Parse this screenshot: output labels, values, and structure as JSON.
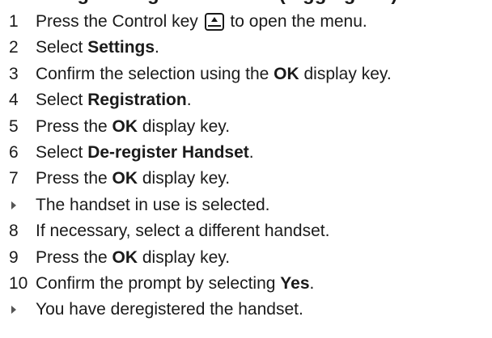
{
  "heading": "Deregistering the handset (logging out)",
  "steps": [
    {
      "num": "1",
      "parts": [
        {
          "t": "Press the Control key "
        },
        {
          "icon": "control-key-icon"
        },
        {
          "t": " to open the menu."
        }
      ]
    },
    {
      "num": "2",
      "parts": [
        {
          "t": "Select "
        },
        {
          "b": "Settings"
        },
        {
          "t": "."
        }
      ]
    },
    {
      "num": "3",
      "parts": [
        {
          "t": "Confirm the selection using the "
        },
        {
          "b": "OK"
        },
        {
          "t": " display key."
        }
      ]
    },
    {
      "num": "4",
      "parts": [
        {
          "t": "Select "
        },
        {
          "b": "Registration"
        },
        {
          "t": "."
        }
      ]
    },
    {
      "num": "5",
      "parts": [
        {
          "t": "Press the "
        },
        {
          "b": "OK"
        },
        {
          "t": " display key."
        }
      ]
    },
    {
      "num": "6",
      "parts": [
        {
          "t": "Select "
        },
        {
          "b": "De-register Handset"
        },
        {
          "t": "."
        }
      ]
    },
    {
      "num": "7",
      "parts": [
        {
          "t": "Press the "
        },
        {
          "b": "OK"
        },
        {
          "t": " display key."
        }
      ]
    },
    {
      "result": true,
      "parts": [
        {
          "t": "The handset in use is selected."
        }
      ]
    },
    {
      "num": "8",
      "parts": [
        {
          "t": "If necessary, select a different handset."
        }
      ]
    },
    {
      "num": "9",
      "parts": [
        {
          "t": "Press the "
        },
        {
          "b": "OK"
        },
        {
          "t": " display key."
        }
      ]
    },
    {
      "num": "10",
      "parts": [
        {
          "t": "Confirm the prompt by selecting "
        },
        {
          "b": "Yes"
        },
        {
          "t": "."
        }
      ]
    },
    {
      "result": true,
      "parts": [
        {
          "t": "You have deregistered the handset."
        }
      ]
    }
  ]
}
